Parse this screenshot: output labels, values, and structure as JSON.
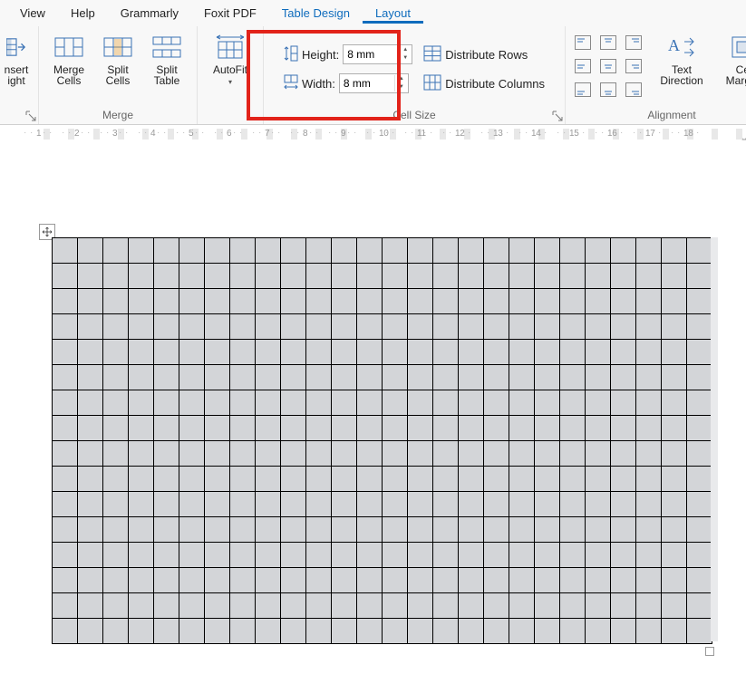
{
  "tabs": {
    "view": "View",
    "help": "Help",
    "grammarly": "Grammarly",
    "foxit": "Foxit PDF",
    "table_design": "Table Design",
    "layout": "Layout"
  },
  "ribbon": {
    "insert_right": "nsert\night",
    "merge": {
      "label": "Merge",
      "merge_cells": "Merge\nCells",
      "split_cells": "Split\nCells",
      "split_table": "Split\nTable"
    },
    "autofit": "AutoFit",
    "cell_size": {
      "label": "Cell Size",
      "height_label": "Height:",
      "width_label": "Width:",
      "height_value": "8 mm",
      "width_value": "8 mm",
      "dist_rows": "Distribute Rows",
      "dist_cols": "Distribute Columns"
    },
    "alignment": {
      "label": "Alignment",
      "text_direction": "Text\nDirection",
      "cell_margins": "Cell\nMargins"
    }
  },
  "ruler": {
    "segments": "· · · 1 · · ·  ·  · · · 2 · · ·  ·  · · · 3 · · ·  ·  · · · 4 · · ·  ·  · · · 5 · · ·  ·  · · · 6 · · ·  ·  · · · 7 · · ·  ·  · · · 8 · · ·  ·  · · · 9 · · ·  ·  · · · 10 · · ·  ·  · · · 11 · · ·  ·  · · · 12 · · ·  ·  · · · 13 · · ·  ·  · · · 14 · · ·  ·  · · · 15 · · ·  ·  · · · 16 · · ·  ·  · · · 17 · · ·  ·  · · · 18 · · ·"
  },
  "table": {
    "rows": 16,
    "cols": 26
  }
}
